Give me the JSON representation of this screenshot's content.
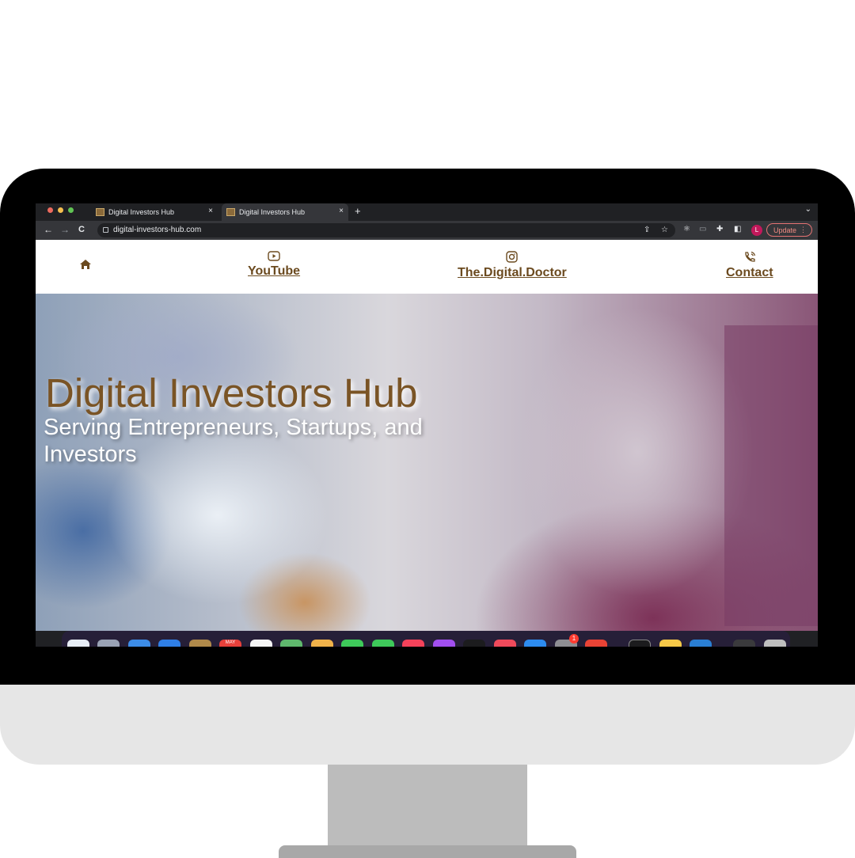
{
  "browser": {
    "tabs": [
      {
        "title": "Digital Investors Hub",
        "close": "×"
      },
      {
        "title": "Digital Investors Hub",
        "close": "×"
      }
    ],
    "new_tab": "+",
    "tab_menu": "⌄",
    "nav": {
      "back": "←",
      "forward": "→",
      "reload": "C"
    },
    "url": "digital-investors-hub.com",
    "avatar_letter": "L",
    "update_label": "Update",
    "menu_dots": "⋮"
  },
  "site": {
    "nav": {
      "home_icon": "home-icon",
      "youtube_label": "YouTube",
      "instagram_label": "The.Digital.Doctor",
      "contact_label": "Contact"
    },
    "hero": {
      "title": "Digital Investors Hub",
      "subtitle": "Serving Entrepreneurs, Startups, and Investors"
    }
  },
  "dock": {
    "calendar_month": "MAY",
    "badge_count": "1"
  },
  "colors": {
    "brand_brown": "#6b4a1f",
    "hero_title": "#7a5425",
    "update_accent": "#f28b82"
  }
}
